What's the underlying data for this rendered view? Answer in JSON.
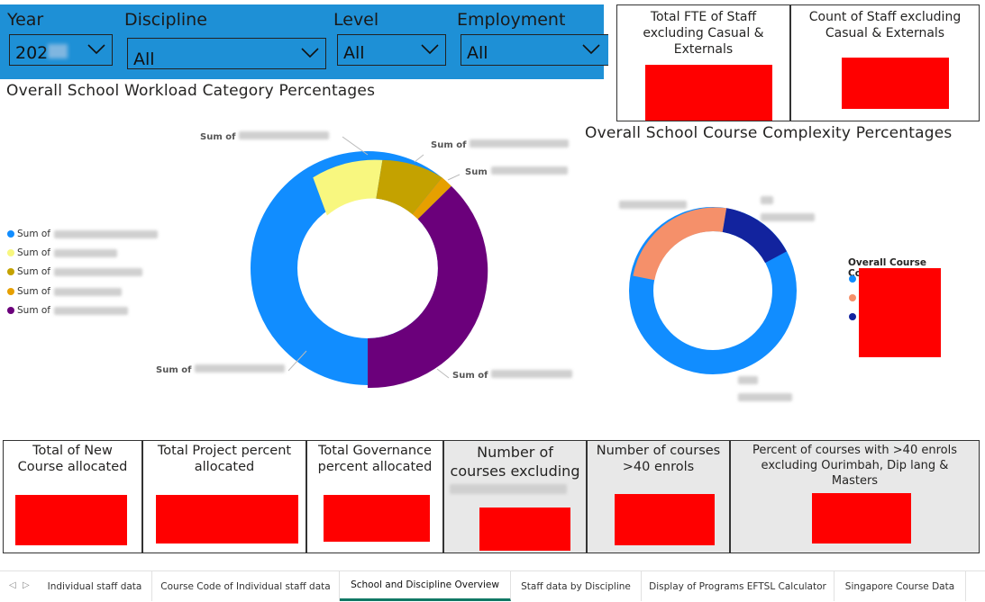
{
  "filters": [
    {
      "label": "Year",
      "value": "202"
    },
    {
      "label": "Discipline",
      "value": "All"
    },
    {
      "label": "Level",
      "value": "All"
    },
    {
      "label": "Employment",
      "value": "All"
    }
  ],
  "kpi_top": [
    {
      "title": "Total FTE of Staff excluding Casual & Externals"
    },
    {
      "title": "Count of Staff excluding Casual & Externals"
    }
  ],
  "workload": {
    "title": "Overall School Workload Category Percentages",
    "legend": [
      "Sum of",
      "Sum of",
      "Sum of",
      "Sum of",
      "Sum of"
    ],
    "labels": [
      "Sum of",
      "Sum of",
      "Sum",
      "Sum of",
      "Sum of"
    ],
    "colors": [
      "#118DFF",
      "#F8F77F",
      "#C4A200",
      "#E6A000",
      "#6B007B"
    ]
  },
  "complexity": {
    "title": "Overall School Course Complexity Percentages",
    "legend_title": "Overall Course Complexity",
    "colors": [
      "#118DFF",
      "#F5906A",
      "#12239E"
    ]
  },
  "kpi_bottom": [
    {
      "title": "Total of New Course allocated"
    },
    {
      "title": "Total Project percent allocated"
    },
    {
      "title": "Total Governance percent allocated"
    },
    {
      "title": "Number of courses excluding"
    },
    {
      "title": "Number of courses >40 enrols"
    },
    {
      "title": "Percent of courses with >40 enrols excluding Ourimbah, Dip lang & Masters"
    }
  ],
  "tabs": [
    "Individual staff data",
    "Course Code of Individual staff data",
    "School and Discipline Overview",
    "Staff data by Discipline",
    "Display of Programs EFTSL Calculator",
    "Singapore Course Data"
  ],
  "active_tab": "School and Discipline Overview"
}
